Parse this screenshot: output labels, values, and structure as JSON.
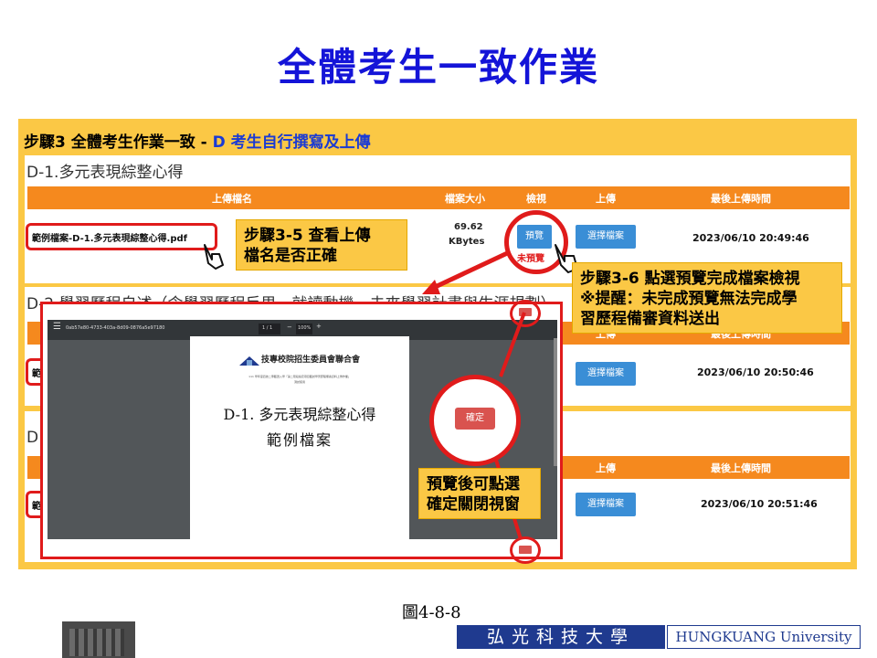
{
  "slide": {
    "title": "全體考生一致作業",
    "caption": "圖4-8-8"
  },
  "step": {
    "prefix": "步驟3 全體考生作業一致 - ",
    "accent": "D 考生自行撰寫及上傳"
  },
  "sections": {
    "d1_title": "D-1.多元表現綜整心得",
    "d2_title": "D-2.學習歷程自述（含學習歷程反思、就讀動機、未來學習計畫與生涯規劃）",
    "d3_prefix": "D"
  },
  "table_header": {
    "filename": "上傳檔名",
    "filesize": "檔案大小",
    "view": "檢視",
    "upload": "上傳",
    "last_upload_time": "最後上傳時間"
  },
  "row1": {
    "filename": "範例檔案-D-1.多元表現綜整心得.pdf",
    "filesize_value": "69.62",
    "filesize_unit": "KBytes",
    "preview_label": "預覽",
    "not_previewed": "未預覽",
    "choose_file": "選擇檔案",
    "time": "2023/06/10 20:49:46"
  },
  "row2": {
    "filename_prefix": "範",
    "choose_file": "選擇檔案",
    "time": "2023/06/10 20:50:46"
  },
  "row3": {
    "filename_prefix": "範",
    "choose_file": "選擇檔案",
    "time": "2023/06/10 20:51:46"
  },
  "callouts": {
    "step35_line1": "步驟3-5 查看上傳",
    "step35_line2": "檔名是否正確",
    "step36_line1": "步驟3-6 點選預覽完成檔案檢視",
    "step36_line2": "※提醒：未完成預覽無法完成學",
    "step36_line3": "習歷程備審資料送出",
    "close_line1": "預覽後可點選",
    "close_line2": "確定關閉視窗"
  },
  "viewer": {
    "doc_id": "0ab57e80-4733-403a-8d09-0876a5e97180",
    "page_indicator": "1 / 1",
    "zoom": "100%",
    "org_name": "技專校院招生委員會聯合會",
    "doc_subtitle": "111 學年度四技二專甄選入學「第二階段指定項目甄試學習歷程備審資料上傳作業」",
    "doc_subtitle2": "測試使用",
    "doc_heading": "D-1. 多元表現綜整心得",
    "doc_subheading": "範例檔案",
    "confirm_label": "確定",
    "close_small": "確定"
  },
  "footer": {
    "cn": "弘光科技大學",
    "en": "HUNGKUANG University"
  },
  "colors": {
    "title_blue": "#1414d8",
    "frame_yellow": "#fbc845",
    "header_orange": "#f5891e",
    "button_blue": "#3a8ed6",
    "highlight_red": "#e01b1b",
    "footer_navy": "#1f3a8f"
  }
}
